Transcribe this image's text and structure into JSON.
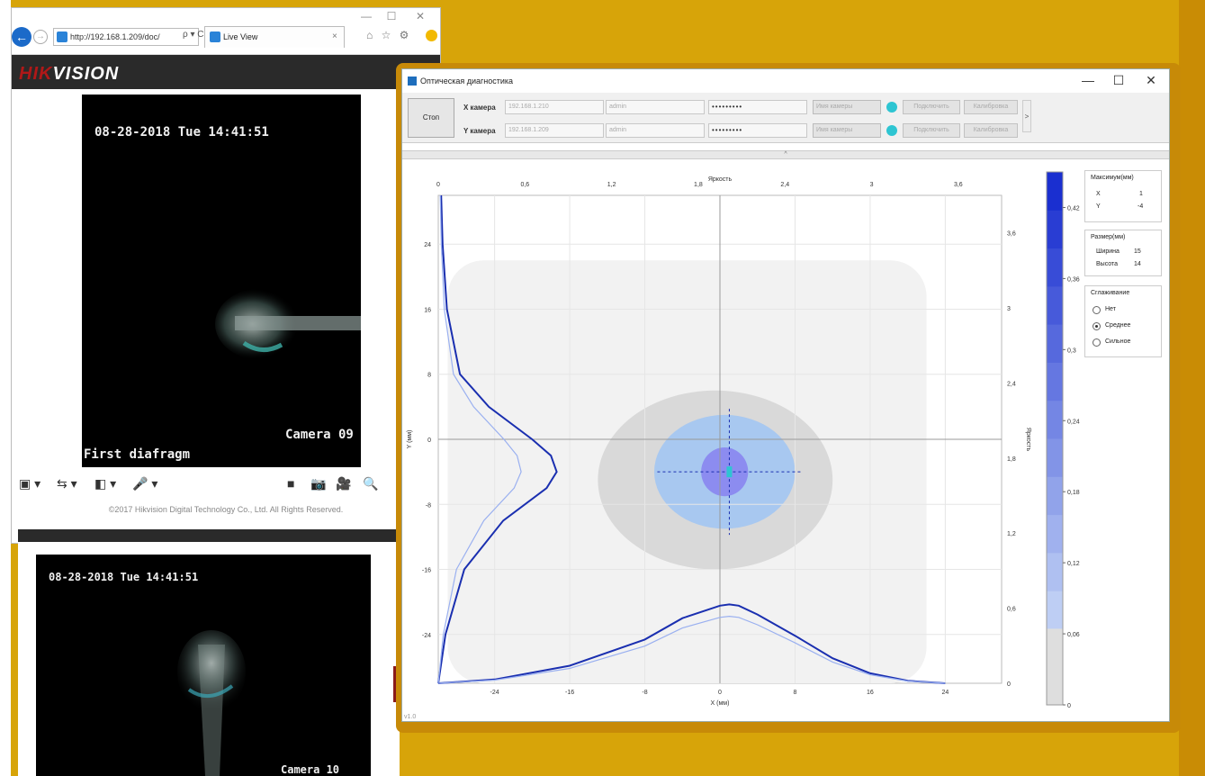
{
  "browser": {
    "address": "http://192.168.1.209/doc/",
    "address_icons": "ρ ▾ C",
    "tab_title": "Live View",
    "tab_close": "×",
    "brand_red": "HIK",
    "brand_white": "VISION",
    "copyright": "©2017 Hikvision Digital Technology Co., Ltd. All Rights Reserved.",
    "window_controls": [
      "—",
      "☐",
      "✕"
    ],
    "toolbar_icons": "⌂ ☆ ⚙"
  },
  "camera1": {
    "timestamp": "08-28-2018 Tue 14:41:51",
    "name": "Camera 09",
    "caption": "First diafragm"
  },
  "camera2": {
    "timestamp": "08-28-2018 Tue 14:41:51",
    "name": "Camera 10"
  },
  "player_bar": {
    "controls": [
      "▣ ▾",
      "⇆ ▾",
      "◧ ▾",
      "🎤 ▾"
    ],
    "right_controls": [
      "■",
      "📷",
      "🎥",
      "🔍"
    ]
  },
  "diag": {
    "title": "Оптическая диагностика",
    "window_controls": [
      "—",
      "☐",
      "✕"
    ],
    "stop_label": "Стоп",
    "x_camera": {
      "label": "X камера",
      "ip": "192.168.1.210",
      "user": "admin",
      "password": "•••••••••",
      "camera_select": "Имя камеры",
      "connect": "Подключить",
      "calibrate": "Калибровка"
    },
    "y_camera": {
      "label": "Y камера",
      "ip": "192.168.1.209",
      "user": "admin",
      "password": "•••••••••",
      "camera_select": "Имя камеры",
      "connect": "Подключить",
      "calibrate": "Калибровка"
    },
    "expand_glyph": ">",
    "splitter_glyph": "^",
    "version": "v1.0",
    "maximum": {
      "title": "Максимум(мм)",
      "x_label": "X",
      "x_value": "1",
      "y_label": "Y",
      "y_value": "-4"
    },
    "size": {
      "title": "Размер(мм)",
      "width_label": "Ширина",
      "width_value": "15",
      "height_label": "Высота",
      "height_value": "14"
    },
    "smoothing": {
      "title": "Сглаживание",
      "options": [
        "Нет",
        "Среднее",
        "Сильное"
      ],
      "selected": 1
    }
  },
  "chart_data": {
    "type": "heatmap",
    "top_axis_title": "Яркость",
    "top_axis_ticks": [
      "0",
      "0,6",
      "1,2",
      "1,8",
      "2,4",
      "3",
      "3,6"
    ],
    "right_axis_title": "Яркость",
    "right_axis_ticks": [
      "0",
      "0,6",
      "1,2",
      "1,8",
      "2,4",
      "3",
      "3,6"
    ],
    "x_axis_title": "X (мм)",
    "x_ticks": [
      "-24",
      "-16",
      "-8",
      "0",
      "8",
      "16",
      "24"
    ],
    "y_axis_title": "Y (мм)",
    "y_ticks": [
      "24",
      "16",
      "8",
      "0",
      "-8",
      "-16",
      "-24"
    ],
    "xlim": [
      -30,
      30
    ],
    "ylim": [
      -30,
      30
    ],
    "colorbar_ticks": [
      "0,42",
      "0,36",
      "0,3",
      "0,24",
      "0,18",
      "0,12",
      "0,06",
      "0"
    ],
    "colorbar_range": [
      0,
      0.45
    ],
    "peak": {
      "x": 1,
      "y": -4
    },
    "contours": [
      {
        "level": "outer",
        "color": "#f2f2f2",
        "x_range": [
          -29,
          22
        ],
        "y_range": [
          -30,
          22
        ]
      },
      {
        "level": "low",
        "color": "#d9d9d9",
        "x_range": [
          -13,
          12
        ],
        "y_range": [
          -16,
          6
        ]
      },
      {
        "level": "mid",
        "color": "#a8c8f0",
        "x_range": [
          -7,
          8
        ],
        "y_range": [
          -11,
          3
        ]
      },
      {
        "level": "high",
        "color": "#8c8cf0",
        "x_range": [
          -2,
          3
        ],
        "y_range": [
          -7,
          -1
        ]
      }
    ],
    "x_profile": {
      "x": [
        -30,
        -24,
        -16,
        -8,
        -4,
        0,
        1,
        2,
        4,
        8,
        12,
        16,
        20,
        24
      ],
      "y": [
        0,
        0.03,
        0.14,
        0.35,
        0.52,
        0.62,
        0.63,
        0.62,
        0.55,
        0.38,
        0.2,
        0.08,
        0.02,
        0
      ]
    },
    "y_profile": {
      "y": [
        30,
        24,
        16,
        8,
        4,
        0,
        -2,
        -4,
        -6,
        -10,
        -16,
        -24,
        -30
      ],
      "x": [
        0.02,
        0.03,
        0.06,
        0.15,
        0.35,
        0.65,
        0.78,
        0.82,
        0.75,
        0.45,
        0.18,
        0.05,
        0
      ]
    },
    "colors": {
      "profile_strong": "#1a2fb0",
      "profile_light": "#9ab0f0",
      "colorbar_top": "#1a2fd0",
      "colorbar_bottom": "#dcebfb"
    }
  }
}
